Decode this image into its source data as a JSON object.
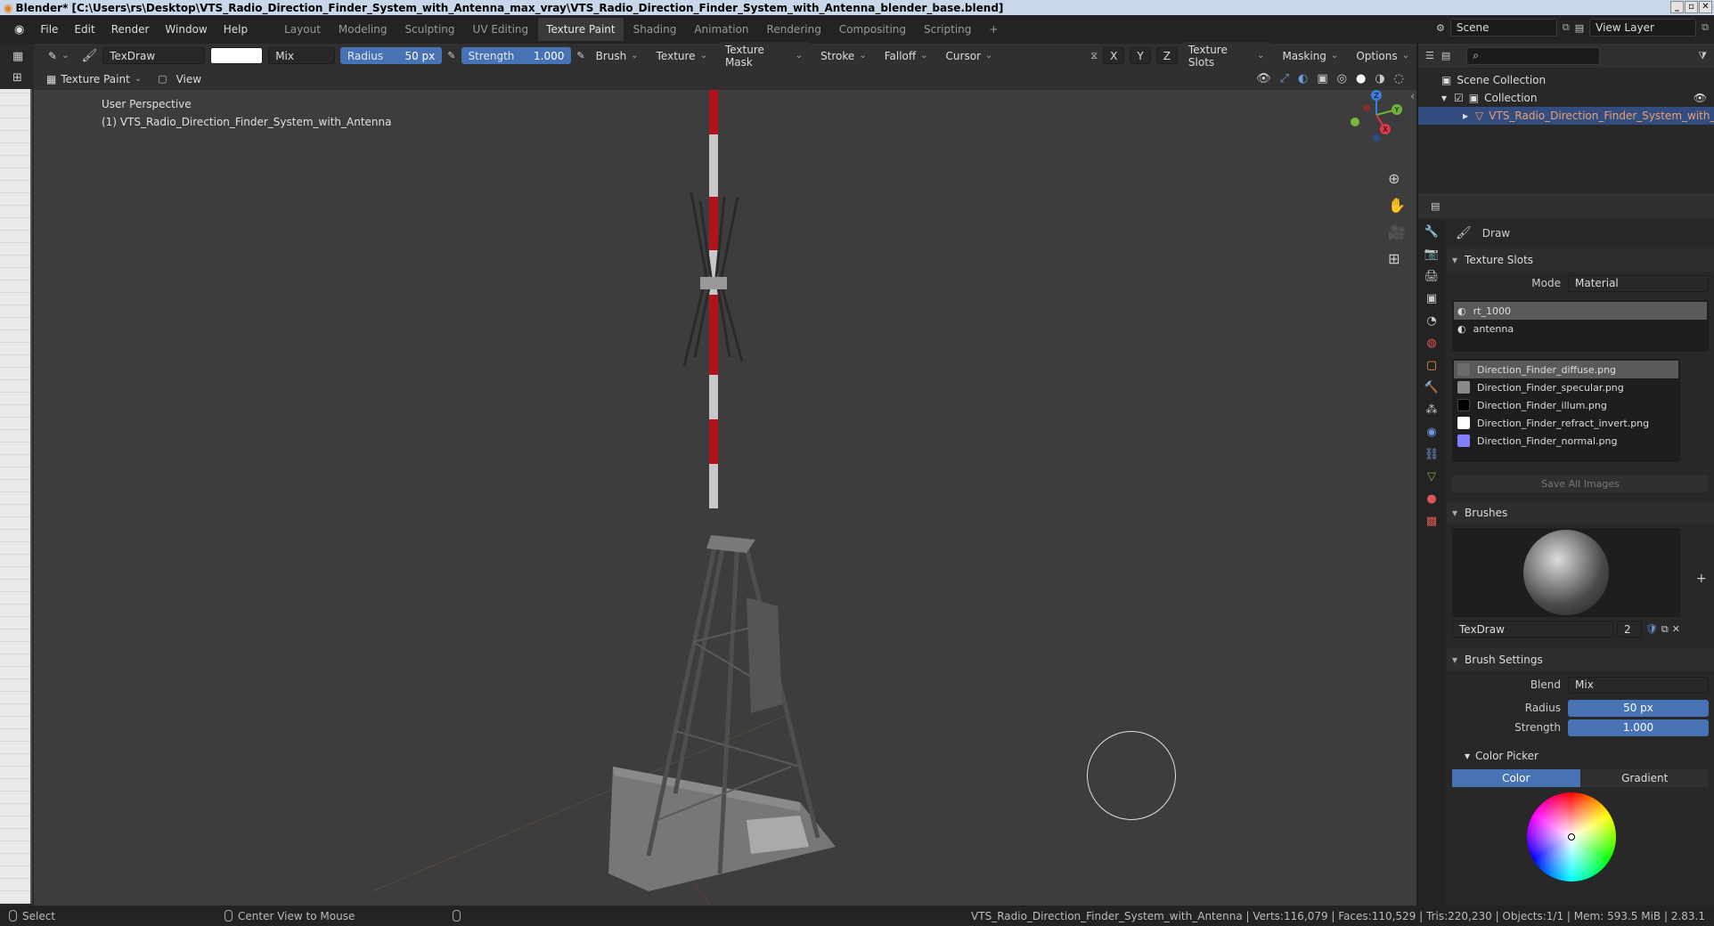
{
  "title": "Blender* [C:\\Users\\rs\\Desktop\\VTS_Radio_Direction_Finder_System_with_Antenna_max_vray\\VTS_Radio_Direction_Finder_System_with_Antenna_blender_base.blend]",
  "menu": [
    "File",
    "Edit",
    "Render",
    "Window",
    "Help"
  ],
  "workspaces": [
    "Layout",
    "Modeling",
    "Sculpting",
    "UV Editing",
    "Texture Paint",
    "Shading",
    "Animation",
    "Rendering",
    "Compositing",
    "Scripting"
  ],
  "active_workspace": "Texture Paint",
  "scene": "Scene",
  "view_layer": "View Layer",
  "tool_header": {
    "brush_name": "TexDraw",
    "blend": "Mix",
    "radius_label": "Radius",
    "radius_value": "50 px",
    "strength_label": "Strength",
    "strength_value": "1.000",
    "menus": [
      "Brush",
      "Texture",
      "Texture Mask",
      "Stroke",
      "Falloff",
      "Cursor"
    ],
    "axes": [
      "X",
      "Y",
      "Z"
    ],
    "right_menus": [
      "Texture Slots",
      "Masking",
      "Options"
    ]
  },
  "viewport_header": {
    "mode": "Texture Paint",
    "view": "View"
  },
  "viewport": {
    "line1": "User Perspective",
    "line2": "(1) VTS_Radio_Direction_Finder_System_with_Antenna",
    "gizmo": {
      "x": "X",
      "y": "Y",
      "z": "Z"
    }
  },
  "outliner": {
    "root": "Scene Collection",
    "collection": "Collection",
    "object": "VTS_Radio_Direction_Finder_System_with_A"
  },
  "properties": {
    "tool_name": "Draw",
    "texture_slots": {
      "title": "Texture Slots",
      "mode_label": "Mode",
      "mode_value": "Material",
      "materials": [
        "rt_1000",
        "antenna"
      ],
      "images": [
        {
          "name": "Direction_Finder_diffuse.png",
          "color": "#6b6b6b"
        },
        {
          "name": "Direction_Finder_specular.png",
          "color": "#8a8a8a"
        },
        {
          "name": "Direction_Finder_illum.png",
          "color": "#000000"
        },
        {
          "name": "Direction_Finder_refract_invert.png",
          "color": "#ffffff"
        },
        {
          "name": "Direction_Finder_normal.png",
          "color": "#8080ff"
        }
      ],
      "save_all": "Save All Images"
    },
    "brushes": {
      "title": "Brushes",
      "name": "TexDraw",
      "users": "2"
    },
    "brush_settings": {
      "title": "Brush Settings",
      "blend_label": "Blend",
      "blend_value": "Mix",
      "radius_label": "Radius",
      "radius_value": "50 px",
      "strength_label": "Strength",
      "strength_value": "1.000"
    },
    "color_picker": {
      "title": "Color Picker",
      "tab_color": "Color",
      "tab_gradient": "Gradient"
    }
  },
  "status": {
    "select": "Select",
    "center": "Center View to Mouse",
    "stats": "VTS_Radio_Direction_Finder_System_with_Antenna | Verts:116,079 | Faces:110,529 | Tris:220,230 | Objects:1/1 | Mem: 593.5 MiB | 2.83.1"
  }
}
